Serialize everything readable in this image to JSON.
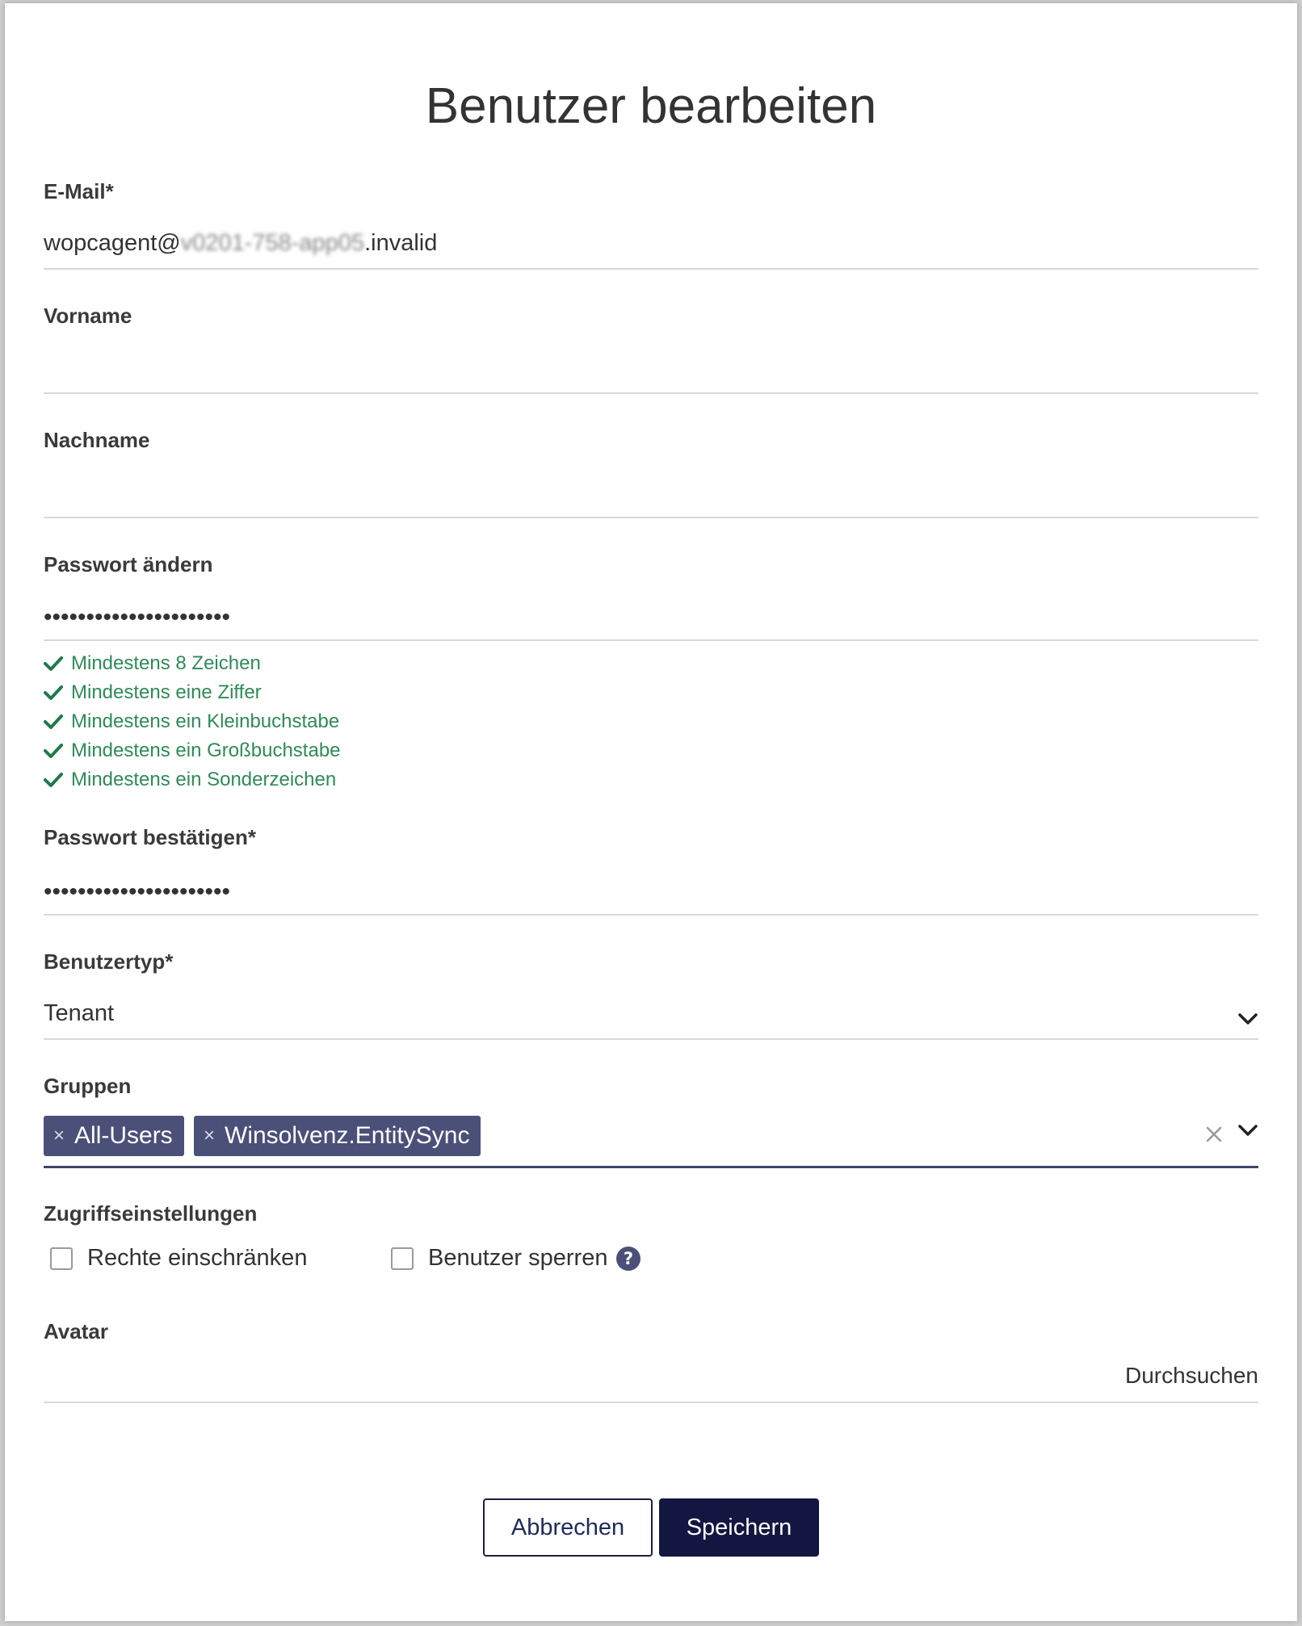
{
  "dialog": {
    "title": "Benutzer bearbeiten"
  },
  "email": {
    "label": "E-Mail*",
    "value_prefix": "wopcagent@",
    "value_blurred": "v0201-758-app05",
    "value_suffix": ".invalid"
  },
  "firstname": {
    "label": "Vorname",
    "value": ""
  },
  "lastname": {
    "label": "Nachname",
    "value": ""
  },
  "password": {
    "label": "Passwort ändern",
    "value": "••••••••••••••••••••••",
    "rules": [
      "Mindestens 8 Zeichen",
      "Mindestens eine Ziffer",
      "Mindestens ein Kleinbuchstabe",
      "Mindestens ein Großbuchstabe",
      "Mindestens ein Sonderzeichen"
    ]
  },
  "password_confirm": {
    "label": "Passwort bestätigen*",
    "value": "••••••••••••••••••••••"
  },
  "user_type": {
    "label": "Benutzertyp*",
    "value": "Tenant"
  },
  "groups": {
    "label": "Gruppen",
    "chips": [
      "All-Users",
      "Winsolvenz.EntitySync"
    ],
    "chip_remove": "×"
  },
  "access": {
    "label": "Zugriffseinstellungen",
    "restrict_rights": "Rechte einschränken",
    "lock_user": "Benutzer sperren"
  },
  "avatar": {
    "label": "Avatar",
    "browse": "Durchsuchen"
  },
  "buttons": {
    "cancel": "Abbrechen",
    "save": "Speichern"
  },
  "colors": {
    "rule_valid": "#2e8b57",
    "chip_bg": "#4a5078",
    "primary": "#121640",
    "help_icon": "#4a5078"
  },
  "icons": [
    "check-icon",
    "chevron-down-icon",
    "close-icon",
    "help-circle-icon"
  ]
}
